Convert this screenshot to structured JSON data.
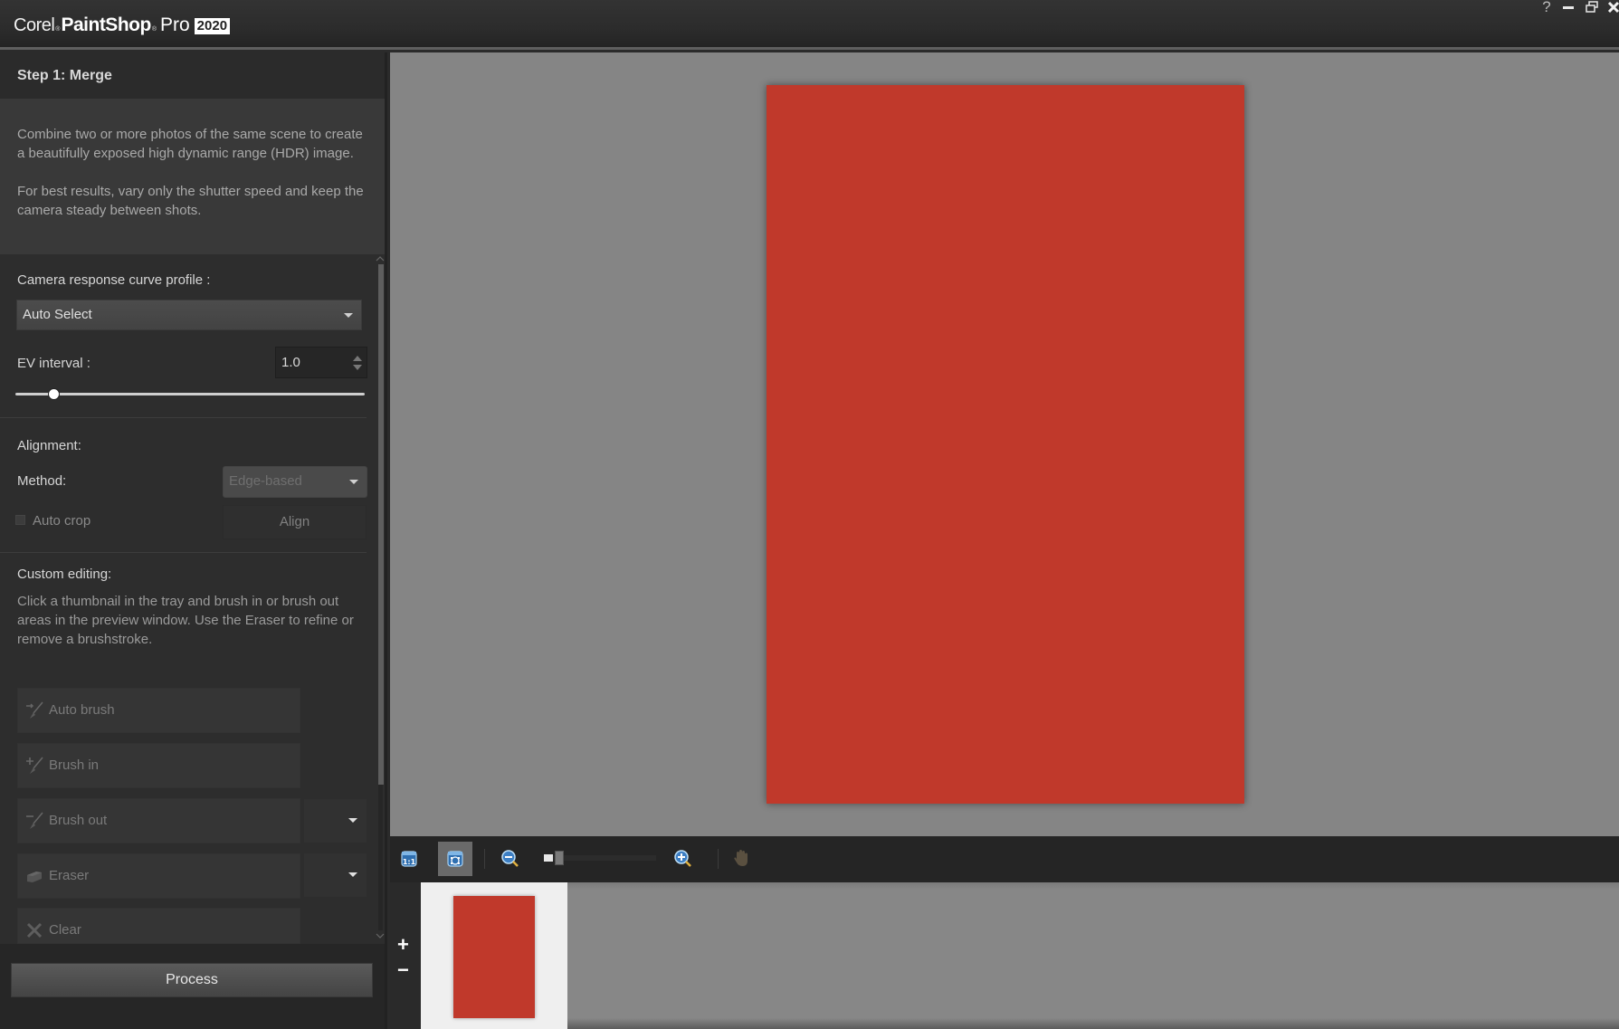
{
  "app": {
    "brand_corel": "Corel",
    "brand_paintshop": "PaintShop",
    "brand_pro": "Pro",
    "brand_year": "2020",
    "window_controls": {
      "help": "?",
      "minimize": "minimize-icon",
      "restore": "restore-icon",
      "close": "close-icon"
    }
  },
  "left_panel": {
    "step_title": "Step 1: Merge",
    "description": [
      "Combine two or more photos of the same scene to create a beautifully exposed high dynamic range (HDR) image.",
      "For best results, vary only the shutter speed and keep the camera steady between shots."
    ],
    "camera_response": {
      "label": "Camera response curve profile :",
      "selected": "Auto Select"
    },
    "ev_interval": {
      "label": "EV interval :",
      "value": "1.0",
      "slider_fraction": 0.11
    },
    "alignment": {
      "heading": "Alignment:",
      "method_label": "Method:",
      "method_selected": "Edge-based",
      "auto_crop_label": "Auto crop",
      "auto_crop_checked": false,
      "align_button": "Align"
    },
    "custom_editing": {
      "heading": "Custom editing:",
      "instructions": "Click a thumbnail in the tray and brush in or brush out areas in the preview window. Use the Eraser to refine or remove a brushstroke."
    },
    "tools": [
      {
        "label": "Auto brush",
        "icon": "auto-brush-icon"
      },
      {
        "label": "Brush in",
        "icon": "brush-in-icon"
      },
      {
        "label": "Brush out",
        "icon": "brush-out-icon"
      },
      {
        "label": "Eraser",
        "icon": "eraser-icon"
      },
      {
        "label": "Clear",
        "icon": "clear-icon"
      }
    ],
    "process_button": "Process"
  },
  "view_toolbar": {
    "actual_size_label": "1:1",
    "zoom_fraction": 0.12,
    "buttons": [
      "actual-size",
      "fit-to-window",
      "zoom-out",
      "zoom-in",
      "pan"
    ]
  },
  "tray": {
    "add_label": "+",
    "remove_label": "−",
    "thumbnail_count": 1
  },
  "colors": {
    "preview_bg": "#858585",
    "panel_bg": "#2d2d2d",
    "accent_blue": "#4a90d9"
  }
}
